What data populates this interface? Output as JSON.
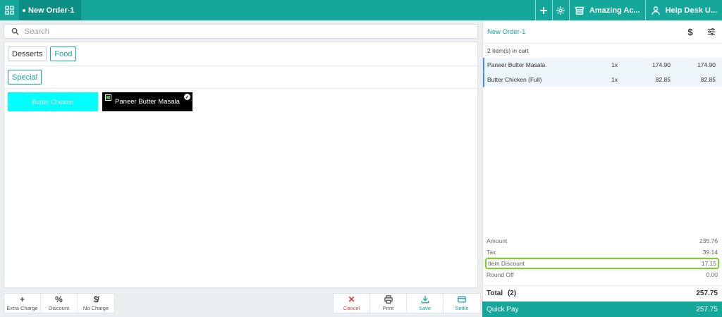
{
  "topbar": {
    "order_tab": "New Order-1",
    "account": "Amazing Ac...",
    "user": "Help Desk U..."
  },
  "search": {
    "placeholder": "Search"
  },
  "categories": [
    "Desserts",
    "Food"
  ],
  "subcategories": [
    "Special"
  ],
  "items": [
    {
      "name": "Butter Chicken",
      "color": "#00ffff"
    },
    {
      "name": "Paneer Butter Masala",
      "color": "#000000"
    }
  ],
  "actions_left": [
    {
      "label": "Extra Charge",
      "icon": "plus-icon"
    },
    {
      "label": "Discount",
      "icon": "percent-icon"
    },
    {
      "label": "No Charge",
      "icon": "no-dollar-icon"
    }
  ],
  "actions_right": [
    {
      "label": "Cancel",
      "icon": "x-icon"
    },
    {
      "label": "Print",
      "icon": "printer-icon"
    },
    {
      "label": "Save",
      "icon": "download-icon"
    },
    {
      "label": "Settle",
      "icon": "card-icon"
    }
  ],
  "cart": {
    "title": "New Order-1",
    "count": "2 item(s) in cart",
    "rows": [
      {
        "name": "Paneer Butter Masala",
        "qty": "1x",
        "price": "174.90",
        "total": "174.90"
      },
      {
        "name": "Butter Chicken (Full)",
        "qty": "1x",
        "price": "82.85",
        "total": "82.85"
      }
    ]
  },
  "summary": {
    "amount_label": "Amount",
    "amount": "235.76",
    "tax_label": "Tax",
    "tax": "39.14",
    "discount_label": "Item Discount",
    "discount": "17.15",
    "roundoff_label": "Round Off",
    "roundoff": "0.00",
    "total_label": "Total",
    "total_count": "(2)",
    "total": "257.75",
    "quickpay_label": "Quick Pay",
    "quickpay": "257.75"
  },
  "colors": {
    "accent": "#16a79b",
    "highlight": "#8bc34a",
    "cancel": "#e53935"
  }
}
